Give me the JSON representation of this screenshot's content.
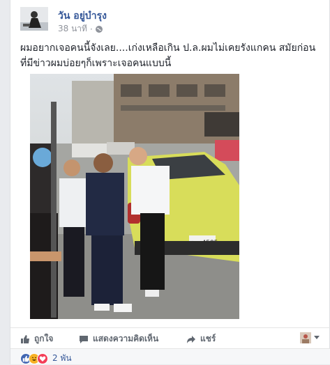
{
  "post": {
    "author": "วัน อยู่บำรุง",
    "time": "38 นาที",
    "separator": "·",
    "privacy_icon": "globe-icon",
    "text": "ผมอยากเจอคนนี้จังเลย....เก่งเหลือเกิน ป.ล.ผมไม่เคยรังแกคน สมัยก่อนที่มีข่าวผมบ่อยๆก็เพราะเจอคนแบบนี้"
  },
  "photo": {
    "plate": "ฆษ 4585"
  },
  "actions": {
    "like_label": "ถูกใจ",
    "comment_label": "แสดงความคิดเห็น",
    "share_label": "แชร์"
  },
  "reactions": {
    "icons": [
      "like-icon",
      "haha-icon",
      "love-icon"
    ],
    "count": "2 พัน"
  },
  "colors": {
    "link": "#365899",
    "like": "#4267b2",
    "haha": "#f7b125",
    "love": "#f33e58",
    "car": "#d8dd5a"
  }
}
